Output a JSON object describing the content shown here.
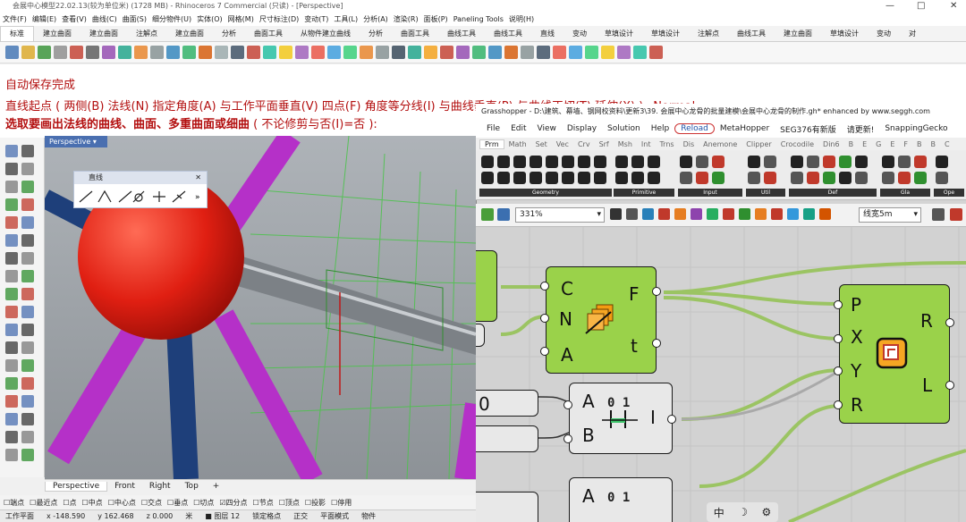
{
  "rhino": {
    "title": "会展中心模型22.02.13(较为单位米) (1728 MB) - Rhinoceros 7 Commercial (只读) - [Perspective]",
    "menu": [
      "文件(F)",
      "编辑(E)",
      "查看(V)",
      "曲线(C)",
      "曲面(S)",
      "细分物件(U)",
      "实体(O)",
      "网格(M)",
      "尺寸标注(D)",
      "变动(T)",
      "工具(L)",
      "分析(A)",
      "渲染(R)",
      "面板(P)",
      "Paneling Tools",
      "说明(H)"
    ],
    "tabs": [
      "标准",
      "建立曲面",
      "建立曲面",
      "注解点",
      "建立曲面",
      "分析",
      "曲面工具",
      "从物件建立曲线",
      "分析",
      "曲面工具",
      "曲线工具",
      "曲线工具",
      "直线",
      "变动",
      "草填设计",
      "草填设计",
      "注解点",
      "曲线工具",
      "建立曲面",
      "草填设计",
      "变动",
      "对"
    ],
    "active_tab": "标准",
    "command": {
      "line1": "自动保存完成",
      "line2": "直线起点 ( 两侧(B)  法线(N)  指定角度(A)  与工作平面垂直(V)  四点(F)  角度等分线(I)  与曲线垂直(P)  与曲线正切(T)  延伸(X)  ):_Normal",
      "line3": "选取要画出法线的曲线、曲面、多重曲面或细曲",
      "line3_suffix": " ( 不论修剪与否(I)=否 ):"
    },
    "viewport": {
      "label": "Perspective",
      "tabs": [
        "Perspective",
        "Front",
        "Right",
        "Top"
      ],
      "active_tab": "Perspective",
      "add_tab_icon": "plus-icon"
    },
    "line_panel": {
      "title": "直线",
      "more": "»"
    },
    "osnap": [
      "端点",
      "最近点",
      "点",
      "中点",
      "中心点",
      "交点",
      "垂点",
      "切点",
      "四分点",
      "节点",
      "顶点",
      "投影",
      "停用"
    ],
    "osnap_checked": [
      "四分点"
    ],
    "status": {
      "plane": "工作平面",
      "x": "x -148.590",
      "y": "y 162.468",
      "z": "z 0.000",
      "unit": "米",
      "layer": "图层 12",
      "lock": "锁定格点",
      "ortho": "正交",
      "planar": "平面模式",
      "object": "物件"
    }
  },
  "gh": {
    "title": "Grasshopper - D:\\建筑、幕墙、钢网校资料\\更新3\\39. 会展中心龙骨的批量建模\\会展中心龙骨的制作.gh*   enhanced by www.seggh.com",
    "menu": [
      "File",
      "Edit",
      "View",
      "Display",
      "Solution",
      "Help",
      "Reload",
      "MetaHopper",
      "SEG376有新版",
      "请更新!",
      "SnappingGecko"
    ],
    "tabs": [
      "Prm",
      "Math",
      "Set",
      "Vec",
      "Crv",
      "Srf",
      "Msh",
      "Int",
      "Trns",
      "Dis",
      "Anemone",
      "Clipper",
      "Crocodile",
      "Din6",
      "B",
      "E",
      "G",
      "E",
      "F",
      "B",
      "B",
      "C"
    ],
    "active_tab": "Prm",
    "ribbon_groups": [
      "Geometry",
      "Primitive",
      "Input",
      "Util",
      "Def",
      "Gla",
      "Ope"
    ],
    "zoom": "331%",
    "preview_label": "线宽5m",
    "components": {
      "evaluate": {
        "inputs": [
          "C",
          "N",
          "A"
        ],
        "outputs": [
          "F",
          "t"
        ]
      },
      "line": {
        "inputs": [
          "P",
          "X",
          "Y",
          "R"
        ],
        "outputs": [
          "R",
          "L"
        ]
      },
      "bool1": {
        "inputs": [
          "A",
          "B"
        ],
        "outputs": [
          "I"
        ],
        "bits": "0 1"
      },
      "bool2": {
        "inputs": [
          "A"
        ],
        "bits": "0 1"
      }
    },
    "panel_value": "0",
    "bottom_icons": [
      "中",
      "moon-icon",
      "gear-icon"
    ]
  }
}
